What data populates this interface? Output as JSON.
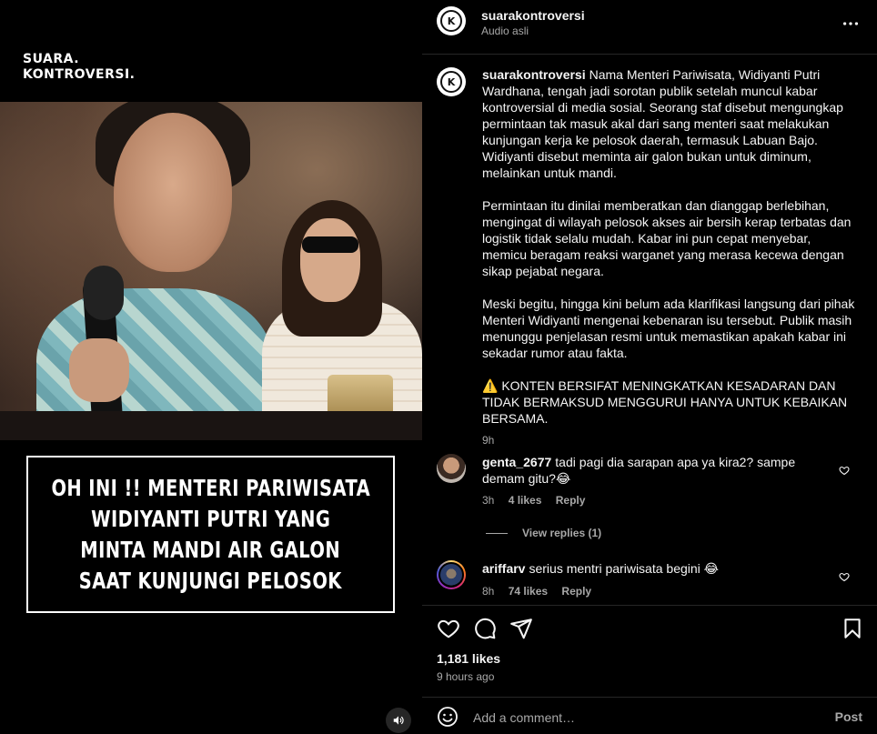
{
  "media": {
    "brand_line1": "SUARA.",
    "brand_line2": "KONTROVERSI.",
    "headline": [
      "OH INI !! MENTERI PARIWISATA",
      "WIDIYANTI PUTRI YANG",
      "MINTA MANDI AIR GALON",
      "SAAT KUNJUNGI PELOSOK"
    ],
    "audio_icon": "speaker-icon"
  },
  "header": {
    "username": "suarakontroversi",
    "audio_label": "Audio asli",
    "avatar_letter": "K",
    "more_icon": "more-horizontal-icon"
  },
  "caption": {
    "username": "suarakontroversi",
    "paragraphs": [
      "Nama Menteri Pariwisata, Widiyanti Putri Wardhana, tengah jadi sorotan publik setelah muncul kabar kontroversial di media sosial. Seorang staf disebut mengungkap permintaan tak masuk akal dari sang menteri saat melakukan kunjungan kerja ke pelosok daerah, termasuk Labuan Bajo. Widiyanti disebut meminta air galon bukan untuk diminum, melainkan untuk mandi.",
      "Permintaan itu dinilai memberatkan dan dianggap berlebihan, mengingat di wilayah pelosok akses air bersih kerap terbatas dan logistik tidak selalu mudah. Kabar ini pun cepat menyebar, memicu beragam reaksi warganet yang merasa kecewa dengan sikap pejabat negara.",
      "Meski begitu, hingga kini belum ada klarifikasi langsung dari pihak Menteri Widiyanti mengenai kebenaran isu tersebut. Publik masih menunggu penjelasan resmi untuk memastikan apakah kabar ini sekadar rumor atau fakta.",
      "⚠️ KONTEN BERSIFAT MENINGKATKAN KESADARAN DAN TIDAK BERMAKSUD MENGGURUI HANYA UNTUK KEBAIKAN BERSAMA."
    ],
    "time": "9h"
  },
  "comments": [
    {
      "username": "genta_2677",
      "text": "tadi pagi dia sarapan apa ya kira2? sampe demam gitu?😂",
      "time": "3h",
      "likes": "4 likes",
      "reply": "Reply",
      "view_replies": "View replies (1)"
    },
    {
      "username": "ariffarv",
      "text": "serius mentri pariwisata begini 😂",
      "time": "8h",
      "likes": "74 likes",
      "reply": "Reply"
    }
  ],
  "actions": {
    "like_icon": "heart-icon",
    "comment_icon": "comment-icon",
    "share_icon": "share-icon",
    "save_icon": "bookmark-icon",
    "likes_count": "1,181 likes",
    "time_ago": "9 hours ago"
  },
  "add_comment": {
    "placeholder": "Add a comment…",
    "post_label": "Post",
    "emoji_icon": "emoji-icon"
  },
  "colors": {
    "background": "#000000",
    "text_primary": "#f5f5f5",
    "text_secondary": "#a8a8a8",
    "divider": "#262626"
  }
}
